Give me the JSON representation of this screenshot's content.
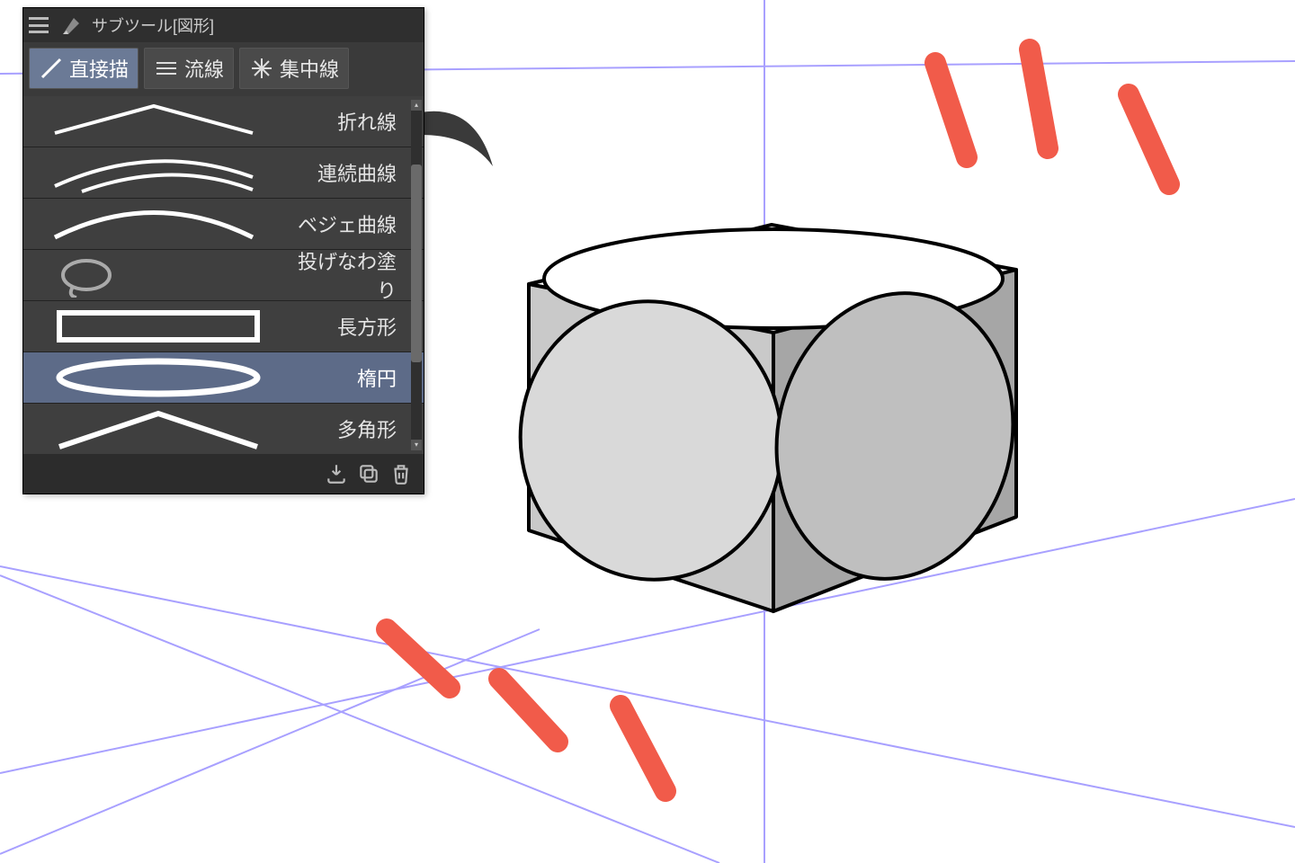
{
  "panel": {
    "title": "サブツール[図形]"
  },
  "tabs": [
    {
      "label": "直接描",
      "active": true
    },
    {
      "label": "流線",
      "active": false
    },
    {
      "label": "集中線",
      "active": false
    }
  ],
  "tools": [
    {
      "name": "polyline",
      "label": "折れ線",
      "selected": false
    },
    {
      "name": "continuous",
      "label": "連続曲線",
      "selected": false
    },
    {
      "name": "bezier",
      "label": "ベジェ曲線",
      "selected": false
    },
    {
      "name": "lasso-fill",
      "label": "投げなわ塗り",
      "selected": false
    },
    {
      "name": "rectangle",
      "label": "長方形",
      "selected": false
    },
    {
      "name": "ellipse",
      "label": "楕円",
      "selected": true
    },
    {
      "name": "polygon",
      "label": "多角形",
      "selected": false
    }
  ],
  "footer_icons": {
    "import": "import-icon",
    "duplicate": "duplicate-icon",
    "delete": "delete-icon"
  },
  "accent_color": "#f15b4a",
  "guide_color": "#a8a0ff"
}
